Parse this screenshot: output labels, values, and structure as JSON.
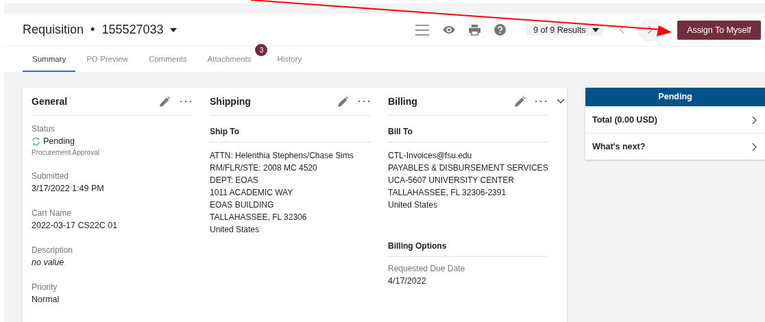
{
  "header": {
    "title": "Requisition",
    "separator": "•",
    "number": "155527033",
    "results": "9 of 9 Results",
    "assign_button": "Assign To Myself"
  },
  "tabs": [
    {
      "label": "Summary",
      "selected": true
    },
    {
      "label": "PO Preview",
      "selected": false
    },
    {
      "label": "Comments",
      "selected": false
    },
    {
      "label": "Attachments",
      "selected": false,
      "badge": "3"
    },
    {
      "label": "History",
      "selected": false
    }
  ],
  "sections": [
    {
      "title": "General",
      "blocks": [
        {
          "kind": "status",
          "label": "Status",
          "value": "Pending",
          "note": "Procurement Approval"
        },
        {
          "kind": "field",
          "label": "Submitted",
          "value": "3/17/2022 1:49 PM"
        },
        {
          "kind": "field",
          "label": "Cart Name",
          "value": "2022-03-17 CS22C 01"
        },
        {
          "kind": "empty",
          "label": "Description",
          "value": "no value"
        },
        {
          "kind": "field",
          "label": "Priority",
          "value": "Normal"
        }
      ]
    },
    {
      "title": "Shipping",
      "blocks": [
        {
          "kind": "heading",
          "text": "Ship To"
        },
        {
          "kind": "lines",
          "lines": [
            "ATTN: Helenthia Stephens/Chase Sims",
            "RM/FLR/STE: 2008 MC 4520",
            "DEPT: EOAS",
            "1011 ACADEMIC WAY",
            "EOAS BUILDING",
            "TALLAHASSEE, FL 32306",
            "United States"
          ]
        }
      ]
    },
    {
      "title": "Billing",
      "blocks": [
        {
          "kind": "heading",
          "text": "Bill To"
        },
        {
          "kind": "lines",
          "lines": [
            "CTL-Invoices@fsu.edu",
            "PAYABLES & DISBURSEMENT SERVICES",
            "UCA-5607 UNIVERSITY CENTER",
            "TALLAHASSEE, FL 32306-2391",
            "United States"
          ]
        },
        {
          "kind": "heading",
          "text": "Billing Options"
        },
        {
          "kind": "field",
          "label": "Requested Due Date",
          "value": "4/17/2022"
        }
      ]
    }
  ],
  "status_panel": {
    "title": "Pending",
    "items": [
      "Total (0.00 USD)",
      "What's next?"
    ]
  }
}
